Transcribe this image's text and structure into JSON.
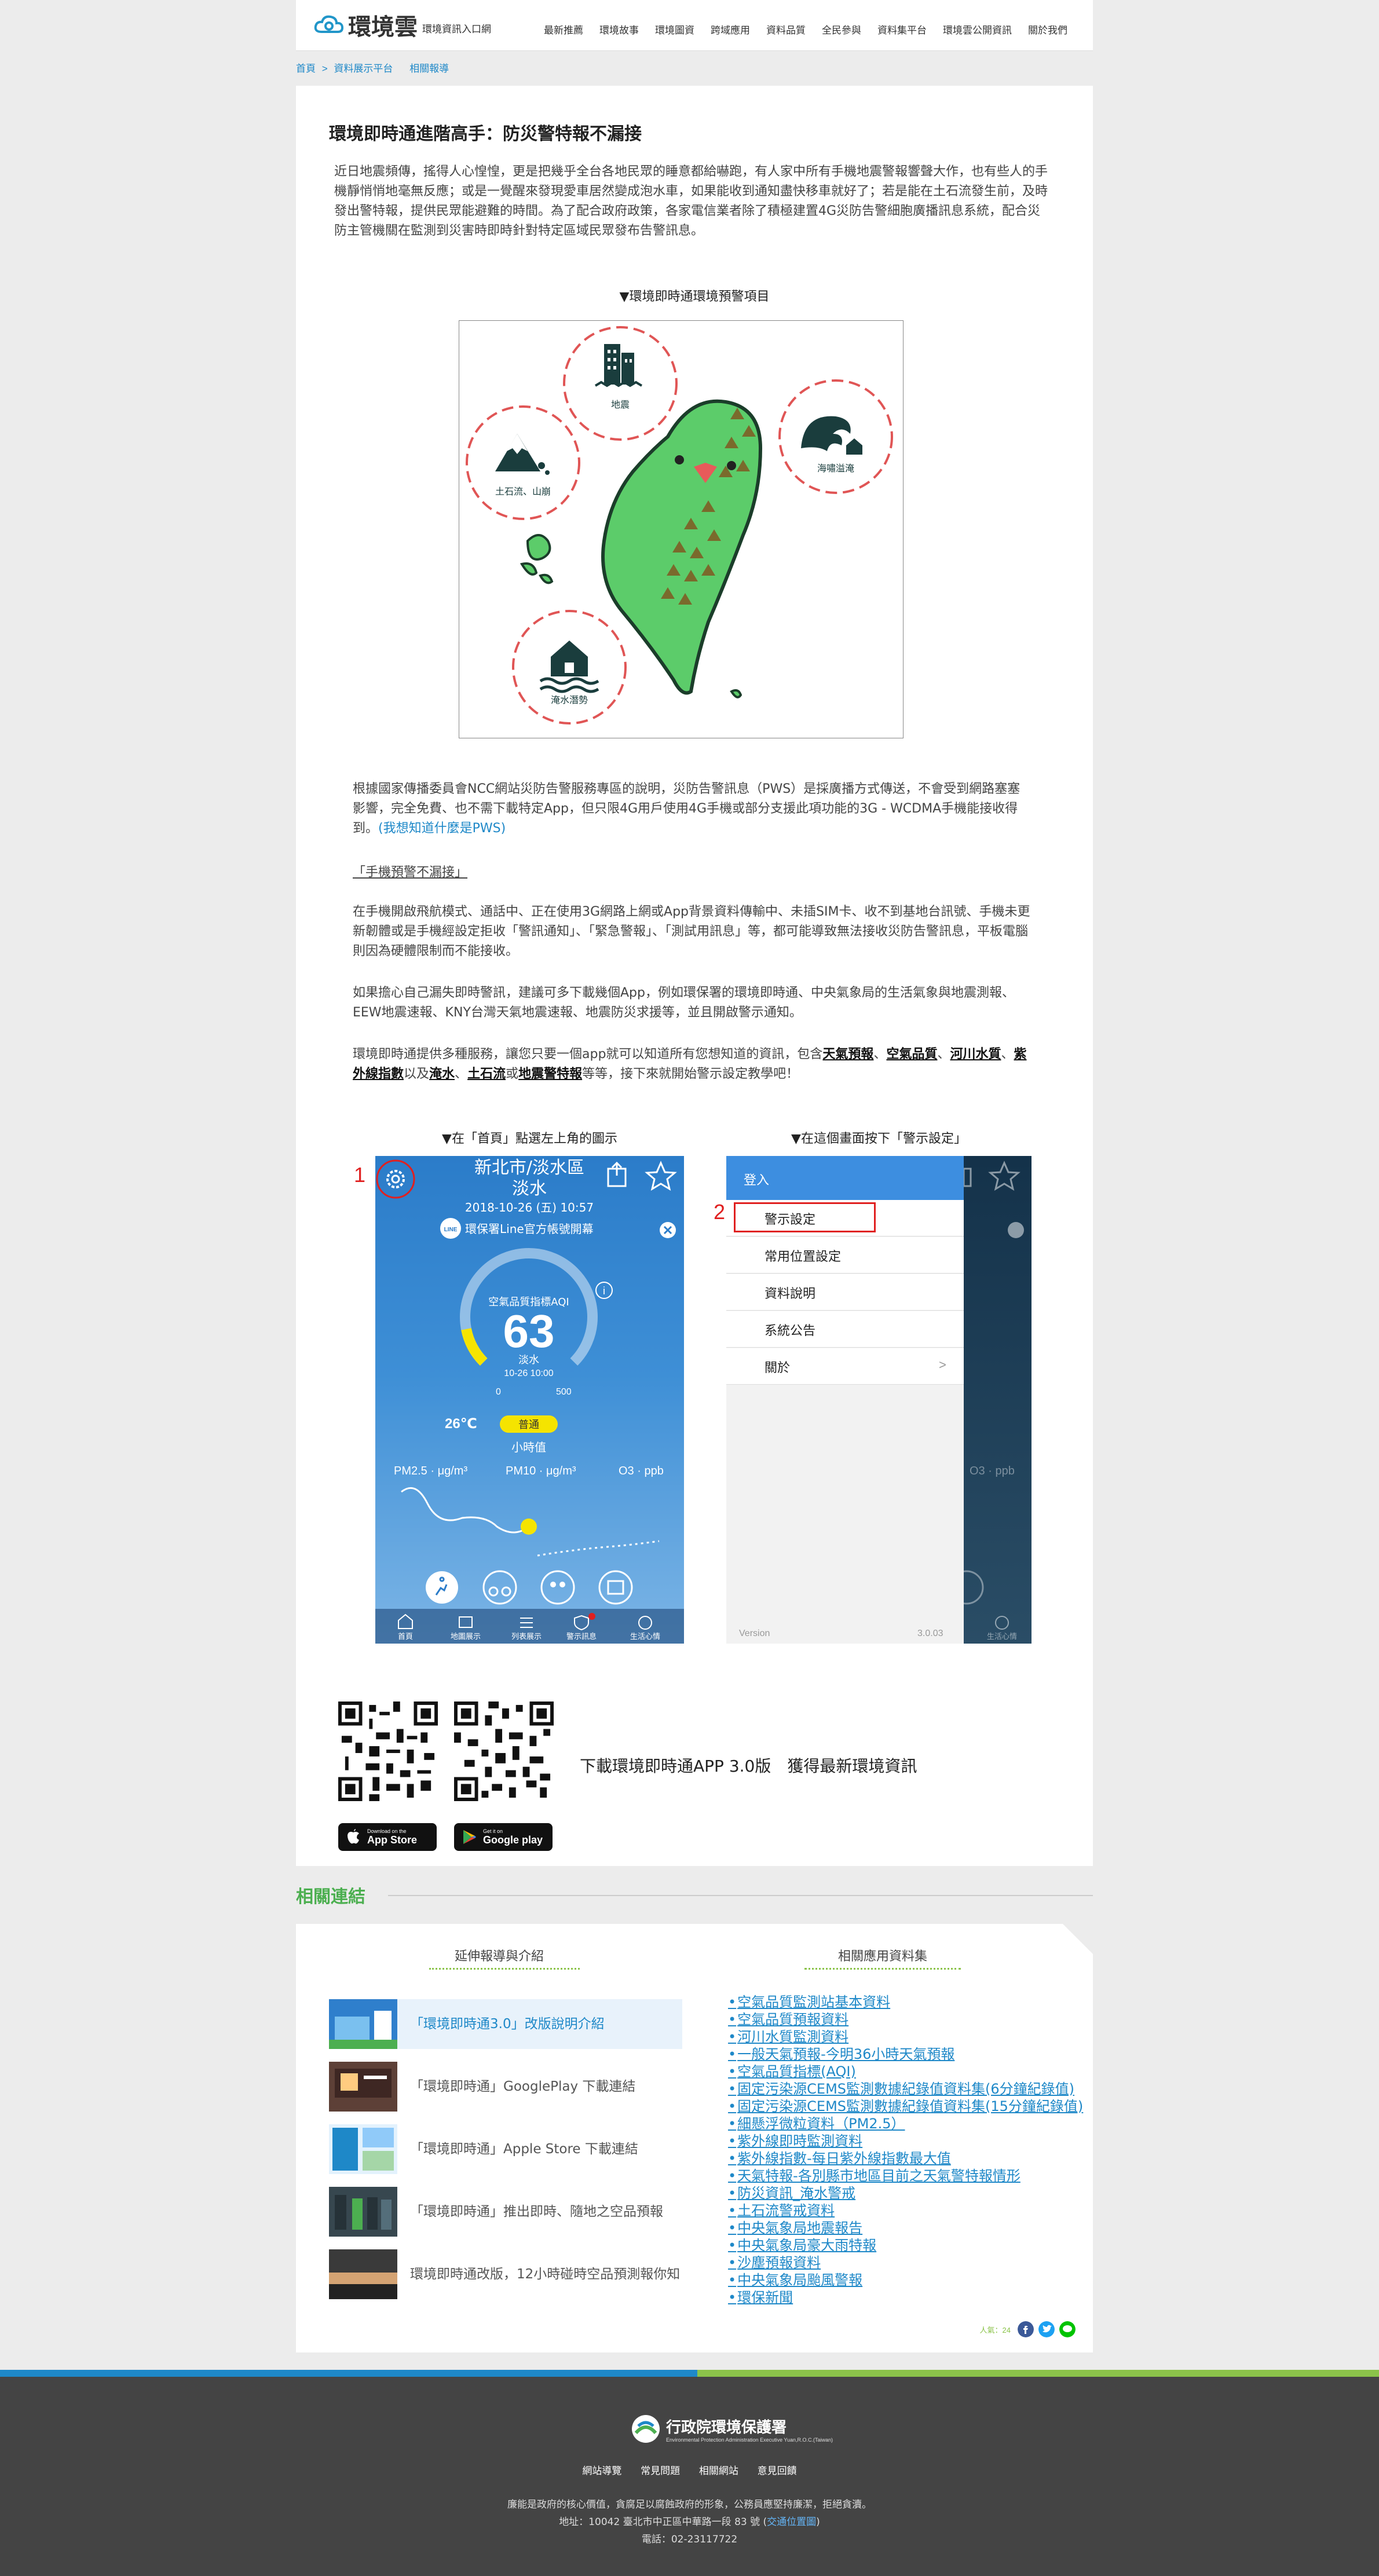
{
  "header": {
    "brand": "環境雲",
    "brand_sub": "環境資訊入口網",
    "nav": [
      "最新推薦",
      "環境故事",
      "環境圖資",
      "跨域應用",
      "資料品質",
      "全民參與",
      "資料集平台",
      "環境雲公開資訊",
      "關於我們"
    ]
  },
  "breadcrumb": {
    "home": "首頁",
    "sep": ">",
    "parent": "資料展示平台",
    "current": "相關報導"
  },
  "article": {
    "title": "環境即時通進階高手：防災警特報不漏接",
    "intro": "近日地震頻傳，搖得人心惶惶，更是把幾乎全台各地民眾的睡意都給嚇跑，有人家中所有手機地震警報響聲大作，也有些人的手機靜悄悄地毫無反應；或是一覺醒來發現愛車居然變成泡水車，如果能收到通知盡快移車就好了；若是能在土石流發生前，及時發出警特報，提供民眾能避難的時間。為了配合政府政策，各家電信業者除了積極建置4G災防告警細胞廣播訊息系統，配合災防主管機關在監測到災害時即時針對特定區域民眾發布告警訊息。",
    "map_caption": "▼環境即時通環境預警項目",
    "map_labels": {
      "earthquake": "地震",
      "landslide": "土石流、山崩",
      "tsunami": "海嘯溢淹",
      "flood": "淹水潛勢"
    },
    "para1": "根據國家傳播委員會NCC網站災防告警服務專區的說明，災防告警訊息（PWS）是採廣播方式傳送，不會受到網路塞塞影響，完全免費、也不需下載特定App，但只限4G用戶使用4G手機或部分支援此項功能的3G - WCDMA手機能接收得到。",
    "para1_link": "(我想知道什麼是PWS)",
    "subhead": "「手機預警不漏接」",
    "para2": "在手機開啟飛航模式、通話中、正在使用3G網路上網或App背景資料傳輸中、未插SIM卡、收不到基地台訊號、手機未更新韌體或是手機經設定拒收「警訊通知」、「緊急警報」、「測試用訊息」等，都可能導致無法接收災防告警訊息，平板電腦則因為硬體限制而不能接收。",
    "para3": "如果擔心自己漏失即時警訊，建議可多下載幾個App，例如環保署的環境即時通、中央氣象局的生活氣象與地震測報、EEW地震速報、KNY台灣天氣地震速報、地震防災求援等，並且開啟警示通知。",
    "para4_a": "環境即時通提供多種服務，讓您只要一個app就可以知道所有您想知道的資訊，包含",
    "para4_items": [
      "天氣預報",
      "空氣品質",
      "河川水質",
      "紫外線指數",
      "淹水",
      "土石流",
      "地震警特報"
    ],
    "para4_sep": [
      "、",
      "、",
      "、",
      "以及",
      "、",
      "或"
    ],
    "para4_b": "等等，接下來就開始警示設定教學吧！",
    "cap_left": "▼在「首頁」點選左上角的圖示",
    "cap_right": "▼在這個畫面按下「警示設定」",
    "download_text": "下載環境即時通APP 3.0版　獲得最新環境資訊"
  },
  "phone1": {
    "step": "1",
    "city": "新北市/淡水區",
    "district": "淡水",
    "datetime": "2018-10-26 (五) 10:57",
    "line_banner": "環保署Line官方帳號開幕",
    "line_badge": "LINE",
    "aqi_label": "空氣品質指標AQI",
    "aqi_value": "63",
    "aqi_place": "淡水",
    "aqi_time": "10-26 10:00",
    "scale_min": "0",
    "scale_max": "500",
    "temp": "26℃",
    "status": "普通",
    "hourly": "小時值",
    "pm25": "PM2.5 · μg/m³",
    "pm10": "PM10 · μg/m³",
    "o3": "O3 · ppb",
    "tabs": [
      "首頁",
      "地圖展示",
      "列表展示",
      "警示訊息",
      "生活心情"
    ],
    "aqi_fraction": 0.126
  },
  "phone2": {
    "step": "2",
    "login": "登入",
    "menu": [
      "警示設定",
      "常用位置設定",
      "資料說明",
      "系統公告",
      "關於"
    ],
    "about_arrow": ">",
    "version_label": "Version",
    "version": "3.0.03",
    "o3": "O3 · ppb",
    "tab_last": "生活心情"
  },
  "stores": {
    "apple_small": "Download on the",
    "apple": "App Store",
    "google_small": "Get it on",
    "google": "Google play"
  },
  "related": {
    "title": "相關連結",
    "left_head": "延伸報導與介紹",
    "right_head": "相關應用資料集",
    "news": [
      "「環境即時通3.0」改版說明介紹",
      "「環境即時通」GooglePlay 下載連結",
      "「環境即時通」Apple Store 下載連結",
      "「環境即時通」推出即時、隨地之空品預報",
      "環境即時通改版，12小時碰時空品預測報你知"
    ],
    "datasets": [
      "空氣品質監測站基本資料",
      "空氣品質預報資料",
      "河川水質監測資料",
      "一般天氣預報-今明36小時天氣預報",
      "空氣品質指標(AQI)",
      "固定污染源CEMS監測數據紀錄值資料集(6分鐘紀錄值)",
      "固定污染源CEMS監測數據紀錄值資料集(15分鐘紀錄值)",
      "細懸浮微粒資料（PM2.5）",
      "紫外線即時監測資料",
      "紫外線指數-每日紫外線指數最大值",
      "天氣特報-各別縣市地區目前之天氣警特報情形",
      "防災資訊_淹水警戒",
      "土石流警戒資料",
      "中央氣象局地震報告",
      "中央氣象局豪大雨特報",
      "沙塵預報資料",
      "中央氣象局颱風警報",
      "環保新聞"
    ],
    "views": "人氣：24"
  },
  "footer": {
    "org": "行政院環境保護署",
    "org_en": "Environmental Protection Administration Executive Yuan,R.O.C.(Taiwan)",
    "links": [
      "網站導覽",
      "常見問題",
      "相關網站",
      "意見回饋"
    ],
    "line1": "廉能是政府的核心價值，貪腐足以腐蝕政府的形象，公務員應堅持廉潔，拒絕貪瀆。",
    "line2_a": "地址：10042 臺北市中正區中華路一段 83 號 (",
    "line2_link": "交通位置圖",
    "line2_b": ")",
    "line3": "電話：02-23117722"
  }
}
